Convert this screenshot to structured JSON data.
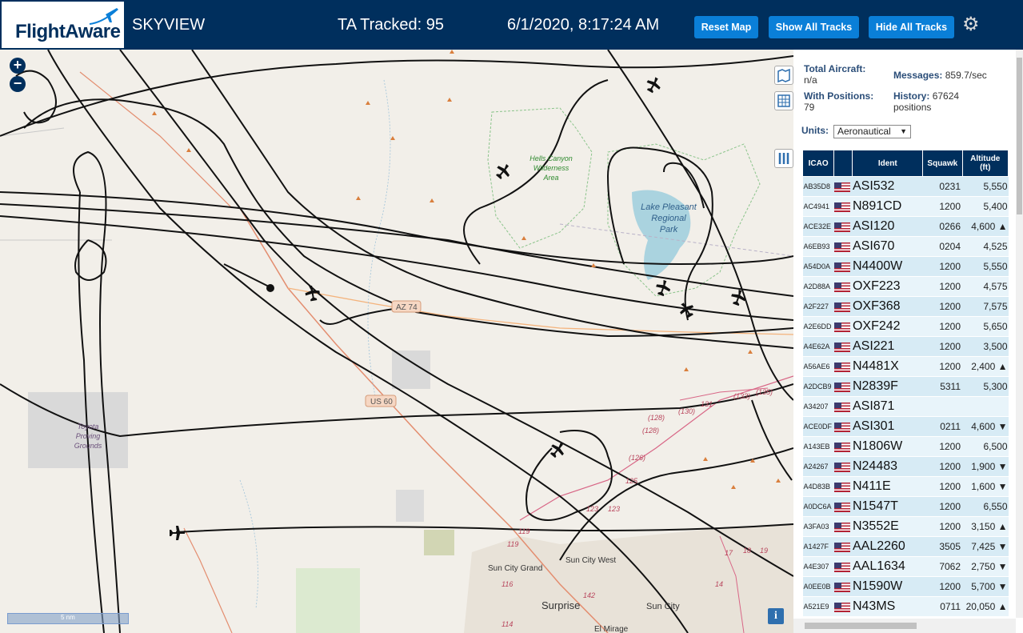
{
  "header": {
    "logo": "FlightAware",
    "title": "SKYVIEW",
    "tracked": "TA Tracked: 95",
    "datetime": "6/1/2020, 8:17:24 AM",
    "buttons": {
      "reset": "Reset Map",
      "show_all": "Show All Tracks",
      "hide_all": "Hide All Tracks"
    }
  },
  "map": {
    "zoom_in": "+",
    "zoom_out": "−",
    "scale_label": "5 nm",
    "info": "i",
    "labels": {
      "hells_canyon": [
        "Hells Canyon",
        "Wilderness",
        "Area"
      ],
      "lake_pleasant": [
        "Lake Pleasant",
        "Regional",
        "Park"
      ],
      "toyota": [
        "Toyota",
        "Proving",
        "Grounds"
      ],
      "az74": "AZ 74",
      "us60": "US 60",
      "sun_city_grand": "Sun City Grand",
      "sun_city_west": "Sun City West",
      "surprise": "Surprise",
      "sun_city": "Sun City",
      "el_mirage": "El Mirage",
      "r128": "(128)",
      "r130": "(130)",
      "r131": "131",
      "r133": "(133)",
      "r135": "(135)",
      "r126": "(126)",
      "r125": "125",
      "r123": "123",
      "r119": "119",
      "r116": "116",
      "r114": "114",
      "r142": "142",
      "r17": "17",
      "r18": "18",
      "r19": "19",
      "r14": "14"
    }
  },
  "panel": {
    "total_aircraft_label": "Total Aircraft:",
    "total_aircraft_value": "n/a",
    "with_positions_label": "With Positions:",
    "with_positions_value": "79",
    "messages_label": "Messages:",
    "messages_value": "859.7/sec",
    "history_label": "History:",
    "history_value": "67624",
    "history_unit": "positions",
    "units_label": "Units:",
    "units_value": "Aeronautical",
    "columns": {
      "icao": "ICAO",
      "ident": "Ident",
      "squawk": "Squawk",
      "altitude": "Altitude",
      "altitude_unit": "(ft)"
    },
    "rows": [
      {
        "icao": "AB35D8",
        "ident": "ASI532",
        "squawk": "0231",
        "alt": "5,550"
      },
      {
        "icao": "AC4941",
        "ident": "N891CD",
        "squawk": "1200",
        "alt": "5,400"
      },
      {
        "icao": "ACE32E",
        "ident": "ASI120",
        "squawk": "0266",
        "alt": "4,600 ▲"
      },
      {
        "icao": "A6EB93",
        "ident": "ASI670",
        "squawk": "0204",
        "alt": "4,525"
      },
      {
        "icao": "A54D0A",
        "ident": "N4400W",
        "squawk": "1200",
        "alt": "5,550"
      },
      {
        "icao": "A2D88A",
        "ident": "OXF223",
        "squawk": "1200",
        "alt": "4,575"
      },
      {
        "icao": "A2F227",
        "ident": "OXF368",
        "squawk": "1200",
        "alt": "7,575"
      },
      {
        "icao": "A2E6DD",
        "ident": "OXF242",
        "squawk": "1200",
        "alt": "5,650"
      },
      {
        "icao": "A4E62A",
        "ident": "ASI221",
        "squawk": "1200",
        "alt": "3,500"
      },
      {
        "icao": "A56AE6",
        "ident": "N4481X",
        "squawk": "1200",
        "alt": "2,400 ▲"
      },
      {
        "icao": "A2DCB9",
        "ident": "N2839F",
        "squawk": "5311",
        "alt": "5,300"
      },
      {
        "icao": "A34207",
        "ident": "ASI871",
        "squawk": "",
        "alt": ""
      },
      {
        "icao": "ACE0DF",
        "ident": "ASI301",
        "squawk": "0211",
        "alt": "4,600 ▼"
      },
      {
        "icao": "A143EB",
        "ident": "N1806W",
        "squawk": "1200",
        "alt": "6,500"
      },
      {
        "icao": "A24267",
        "ident": "N24483",
        "squawk": "1200",
        "alt": "1,900 ▼"
      },
      {
        "icao": "A4D83B",
        "ident": "N411E",
        "squawk": "1200",
        "alt": "1,600 ▼"
      },
      {
        "icao": "A0DC6A",
        "ident": "N1547T",
        "squawk": "1200",
        "alt": "6,550"
      },
      {
        "icao": "A3FA03",
        "ident": "N3552E",
        "squawk": "1200",
        "alt": "3,150 ▲"
      },
      {
        "icao": "A1427F",
        "ident": "AAL2260",
        "squawk": "3505",
        "alt": "7,425 ▼"
      },
      {
        "icao": "A4E307",
        "ident": "AAL1634",
        "squawk": "7062",
        "alt": "2,750 ▼"
      },
      {
        "icao": "A0EE0B",
        "ident": "N1590W",
        "squawk": "1200",
        "alt": "5,700 ▼"
      },
      {
        "icao": "A521E9",
        "ident": "N43MS",
        "squawk": "0711",
        "alt": "20,050 ▲"
      }
    ]
  },
  "colors": {
    "header_bg": "#002f5d",
    "button_bg": "#0a7fd8",
    "row_bg": "#d7ebf5",
    "track": "#000000"
  }
}
